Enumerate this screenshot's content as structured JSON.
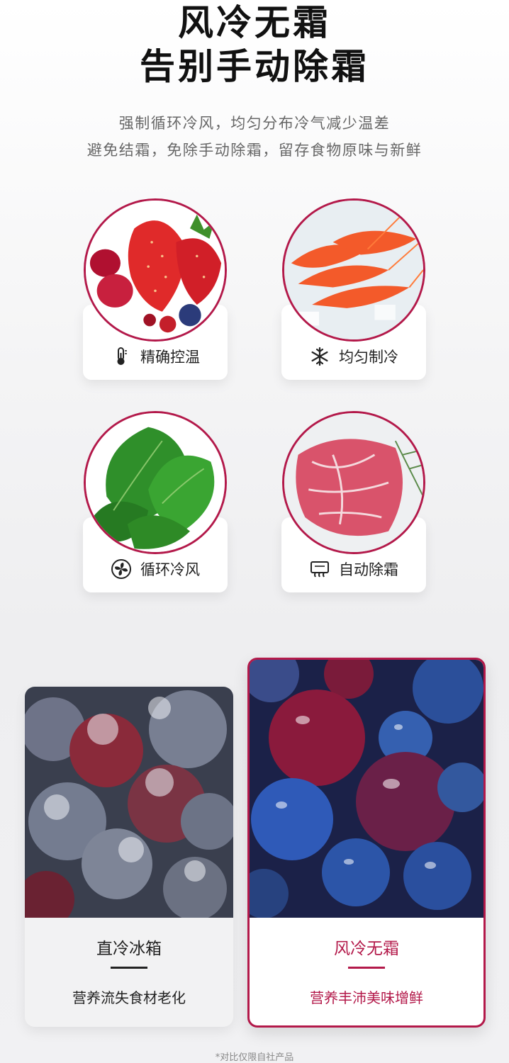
{
  "header": {
    "title_line1": "风冷无霜",
    "title_line2": "告别手动除霜",
    "subtitle_line1": "强制循环冷风，均匀分布冷气减少温差",
    "subtitle_line2": "避免结霜，免除手动除霜，留存食物原味与新鲜"
  },
  "features": [
    {
      "label": "精确控温",
      "icon": "thermometer-icon",
      "image": "strawberries-berries"
    },
    {
      "label": "均匀制冷",
      "icon": "snowflake-icon",
      "image": "shrimp-on-ice"
    },
    {
      "label": "循环冷风",
      "icon": "fan-icon",
      "image": "leafy-greens"
    },
    {
      "label": "自动除霜",
      "icon": "defrost-icon",
      "image": "marbled-beef"
    }
  ],
  "comparison": {
    "left": {
      "title": "直冷冰箱",
      "desc": "营养流失食材老化",
      "image": "frosted-berries"
    },
    "right": {
      "title": "风冷无霜",
      "desc": "营养丰沛美味增鲜",
      "image": "fresh-berries"
    }
  },
  "footnote": "*对比仅限自社产品",
  "colors": {
    "accent": "#b3194a",
    "text": "#222222",
    "muted": "#666666"
  }
}
